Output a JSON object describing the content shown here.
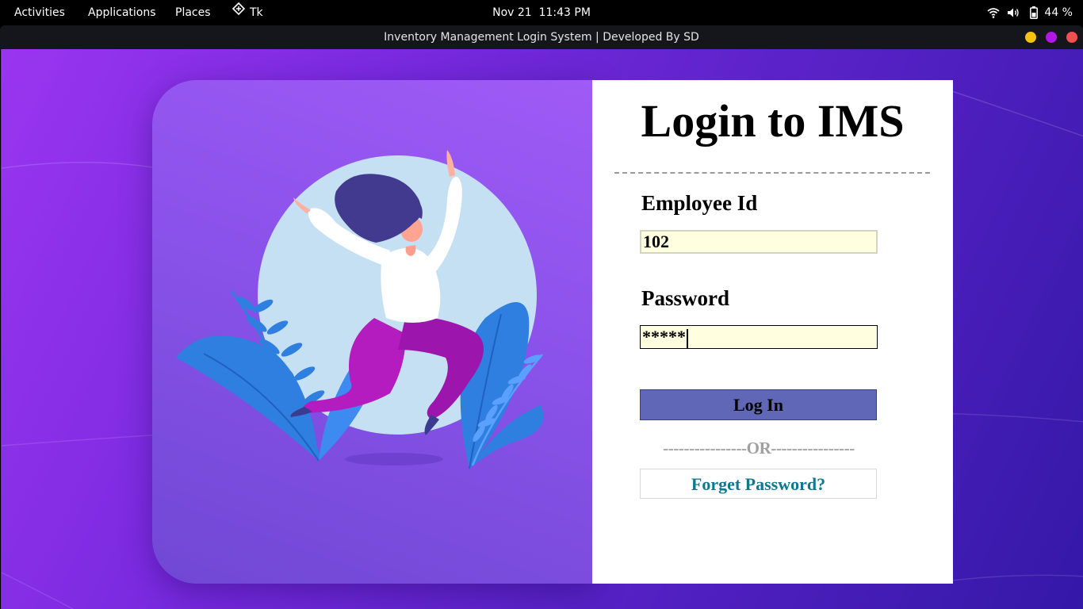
{
  "topbar": {
    "activities": "Activities",
    "applications": "Applications",
    "places": "Places",
    "app_name": "Tk",
    "clock": "Nov 21  11:43 PM",
    "battery": "44 %"
  },
  "window": {
    "title": "Inventory Management Login System | Developed By SD",
    "buttons": {
      "minimize_color": "#f5c211",
      "maximize_color": "#b217e6",
      "close_color": "#f0504f"
    }
  },
  "login": {
    "title": "Login to IMS",
    "employee_label": "Employee Id",
    "employee_value": "102",
    "password_label": "Password",
    "password_value": "*****",
    "login_button": "Log In",
    "or_text": "----------------OR----------------",
    "forget_button": "Forget Password?"
  },
  "colors": {
    "field_bg": "#ffffdf",
    "login_button_bg": "#6067b6",
    "forget_text": "#0f7792",
    "card_purple": "#8a52ea"
  }
}
